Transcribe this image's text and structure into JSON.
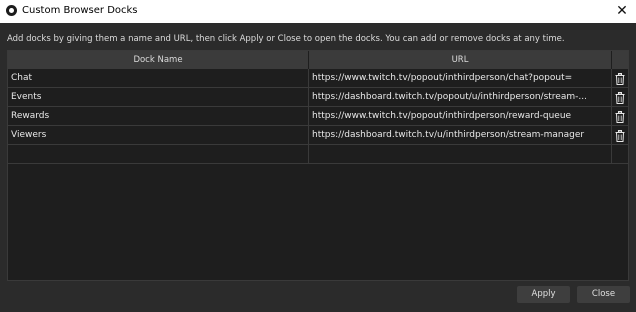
{
  "window": {
    "title": "Custom Browser Docks"
  },
  "instructions": "Add docks by giving them a name and URL, then click Apply or Close to open the docks. You can add or remove docks at any time.",
  "table": {
    "columns": [
      "Dock Name",
      "URL"
    ],
    "rows": [
      {
        "name": "Chat",
        "url": "https://www.twitch.tv/popout/inthirdperson/chat?popout="
      },
      {
        "name": "Events",
        "url": "https://dashboard.twitch.tv/popout/u/inthirdperson/stream-..."
      },
      {
        "name": "Rewards",
        "url": "https://www.twitch.tv/popout/inthirdperson/reward-queue"
      },
      {
        "name": "Viewers",
        "url": "https://dashboard.twitch.tv/u/inthirdperson/stream-manager"
      }
    ],
    "new_row": {
      "name": "",
      "url": ""
    },
    "row_action_icon": "trash-icon"
  },
  "buttons": {
    "apply": "Apply",
    "close": "Close"
  }
}
